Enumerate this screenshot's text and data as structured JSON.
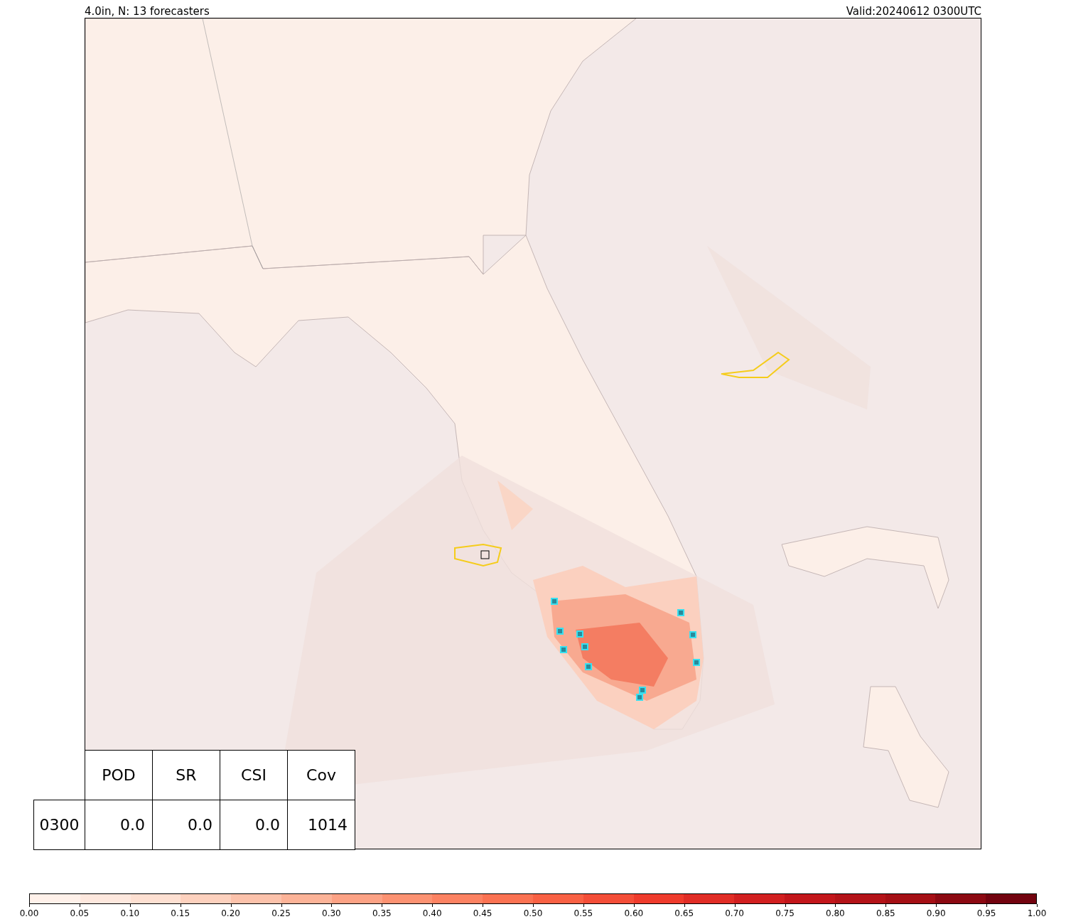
{
  "header": {
    "left": "4.0in, N: 13 forecasters",
    "right": "Valid:20240612 0300UTC"
  },
  "table": {
    "columns": [
      "POD",
      "SR",
      "CSI",
      "Cov"
    ],
    "rows": [
      {
        "label": "0300",
        "cells": [
          "0.0",
          "0.0",
          "0.0",
          "1014"
        ]
      }
    ]
  },
  "colorbar": {
    "ticks": [
      "0.00",
      "0.05",
      "0.10",
      "0.15",
      "0.20",
      "0.25",
      "0.30",
      "0.35",
      "0.40",
      "0.45",
      "0.50",
      "0.55",
      "0.60",
      "0.65",
      "0.70",
      "0.75",
      "0.80",
      "0.85",
      "0.90",
      "0.95",
      "1.00"
    ]
  }
}
